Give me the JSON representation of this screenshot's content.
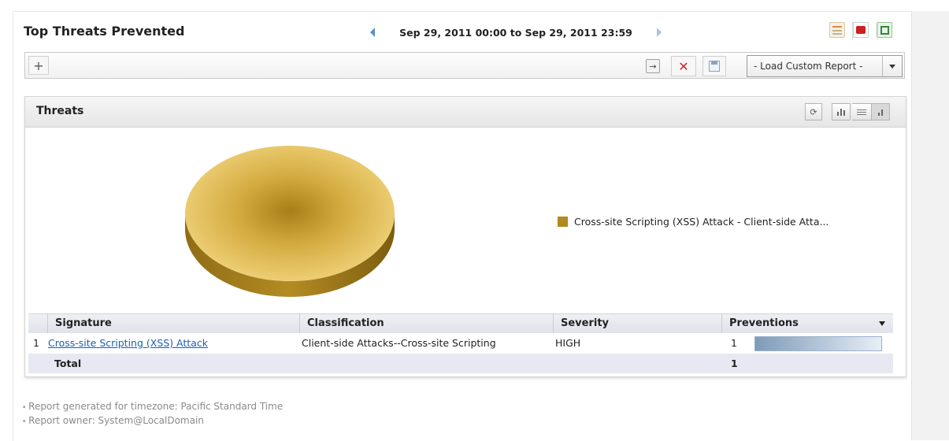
{
  "report": {
    "title": "Top Threats Prevented",
    "date_range": "Sep 29, 2011 00:00 to Sep 29, 2011 23:59"
  },
  "toolbar": {
    "add_symbol": "+",
    "filter_value": "",
    "go_symbol": "→",
    "clear_symbol": "✕",
    "custom_report_selected": "- Load Custom Report -"
  },
  "panel": {
    "title": "Threats",
    "refresh_symbol": "⟳"
  },
  "chart_data": {
    "type": "pie",
    "slices": [
      {
        "label": "Cross-site Scripting (XSS) Attack - Client-side Atta...",
        "value": 1,
        "color": "#b08a1e"
      }
    ],
    "legend_position": "right"
  },
  "table": {
    "columns": [
      "Signature",
      "Classification",
      "Severity",
      "Preventions"
    ],
    "rows": [
      {
        "index": "1",
        "signature": "Cross-site Scripting (XSS) Attack",
        "classification": "Client-side Attacks--Cross-site Scripting",
        "severity": "HIGH",
        "preventions": "1",
        "preventions_fraction": 1.0
      }
    ],
    "total_label": "Total",
    "total_value": "1"
  },
  "footnotes": {
    "timezone": "Report generated for timezone: Pacific Standard Time",
    "owner": "Report owner: System@LocalDomain"
  },
  "colors": {
    "pie": "#d4ad42",
    "link": "#1a5fb4",
    "clear": "#d12222"
  }
}
